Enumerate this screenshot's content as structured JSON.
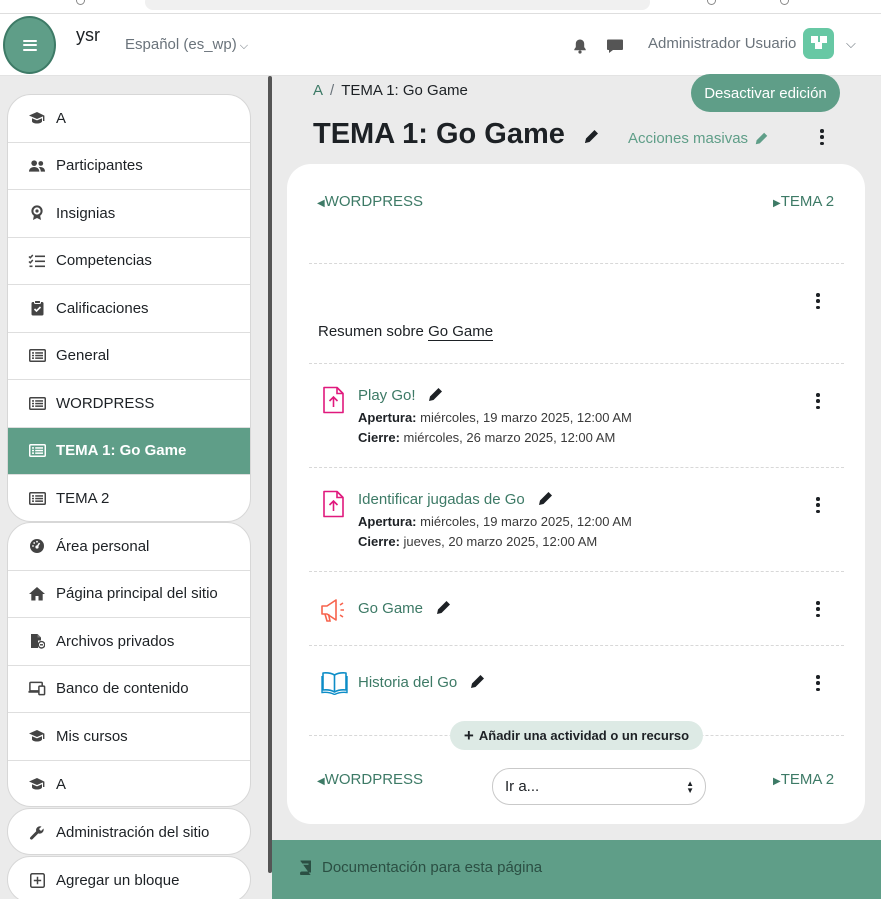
{
  "navbar": {
    "site_name": "ysr",
    "language": "Español (es_wp)",
    "user_name": "Administrador Usuario"
  },
  "drawer": {
    "course_items": [
      {
        "label": "A",
        "icon": "graduation-cap-icon"
      },
      {
        "label": "Participantes",
        "icon": "users-icon"
      },
      {
        "label": "Insignias",
        "icon": "badge-icon"
      },
      {
        "label": "Competencias",
        "icon": "checklist-icon"
      },
      {
        "label": "Calificaciones",
        "icon": "clipboard-check-icon"
      },
      {
        "label": "General",
        "icon": "section-list-icon"
      },
      {
        "label": "WORDPRESS",
        "icon": "section-list-icon"
      },
      {
        "label": "TEMA 1: Go Game",
        "icon": "section-list-icon",
        "active": true
      },
      {
        "label": "TEMA 2",
        "icon": "section-list-icon"
      }
    ],
    "site_items": [
      {
        "label": "Área personal",
        "icon": "dashboard-icon"
      },
      {
        "label": "Página principal del sitio",
        "icon": "home-icon"
      },
      {
        "label": "Archivos privados",
        "icon": "private-files-icon"
      },
      {
        "label": "Banco de contenido",
        "icon": "content-bank-icon"
      },
      {
        "label": "Mis cursos",
        "icon": "graduation-cap-icon"
      },
      {
        "label": "A",
        "icon": "graduation-cap-icon"
      }
    ],
    "admin_item": {
      "label": "Administración del sitio",
      "icon": "wrench-icon"
    },
    "add_block_item": {
      "label": "Agregar un bloque",
      "icon": "plus-square-icon"
    }
  },
  "main": {
    "breadcrumb": {
      "course": "A",
      "current": "TEMA 1: Go Game"
    },
    "edit_toggle_label": "Desactivar edición",
    "title": "TEMA 1: Go Game",
    "bulk_actions_label": "Acciones masivas",
    "prev_section": "WORDPRESS",
    "next_section": "TEMA 2",
    "summary_prefix": "Resumen sobre",
    "summary_link": "Go Game",
    "activities": [
      {
        "title": "Play Go!",
        "icon": "assignment-icon",
        "opening_label": "Apertura:",
        "opening": "miércoles, 19 marzo 2025, 12:00 AM",
        "closing_label": "Cierre:",
        "closing": "miércoles, 26 marzo 2025, 12:00 AM"
      },
      {
        "title": "Identificar jugadas de Go",
        "icon": "assignment-icon",
        "opening_label": "Apertura:",
        "opening": "miércoles, 19 marzo 2025, 12:00 AM",
        "closing_label": "Cierre:",
        "closing": "jueves, 20 marzo 2025, 12:00 AM"
      },
      {
        "title": "Go Game",
        "icon": "forum-megaphone-icon"
      },
      {
        "title": "Historia del Go",
        "icon": "book-icon"
      }
    ],
    "add_activity_label": "Añadir una actividad o un recurso",
    "goto_placeholder": "Ir a...",
    "footer_link": "Documentación para esta página"
  },
  "colors": {
    "accent": "#5f9e88",
    "accent_dark": "#3d7a66",
    "assignment_icon": "#e0197d",
    "forum_icon": "#f7634d",
    "book_icon": "#0d8dc7"
  }
}
